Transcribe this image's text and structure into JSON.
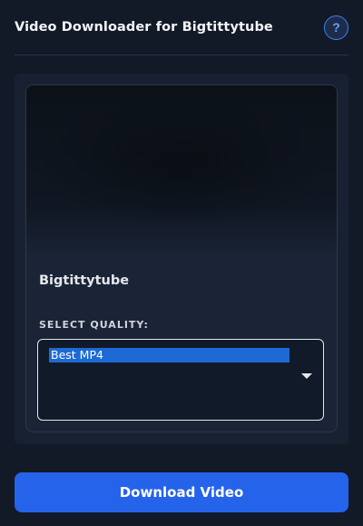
{
  "header": {
    "title": "Video Downloader for Bigtittytube",
    "help_label": "?"
  },
  "video": {
    "title": "Bigtittytube"
  },
  "quality": {
    "label": "SELECT QUALITY:",
    "selected": "Best MP4"
  },
  "actions": {
    "download_label": "Download Video"
  },
  "colors": {
    "accent": "#2563eb",
    "background": "#121a27",
    "selection": "#1d6ad4"
  }
}
